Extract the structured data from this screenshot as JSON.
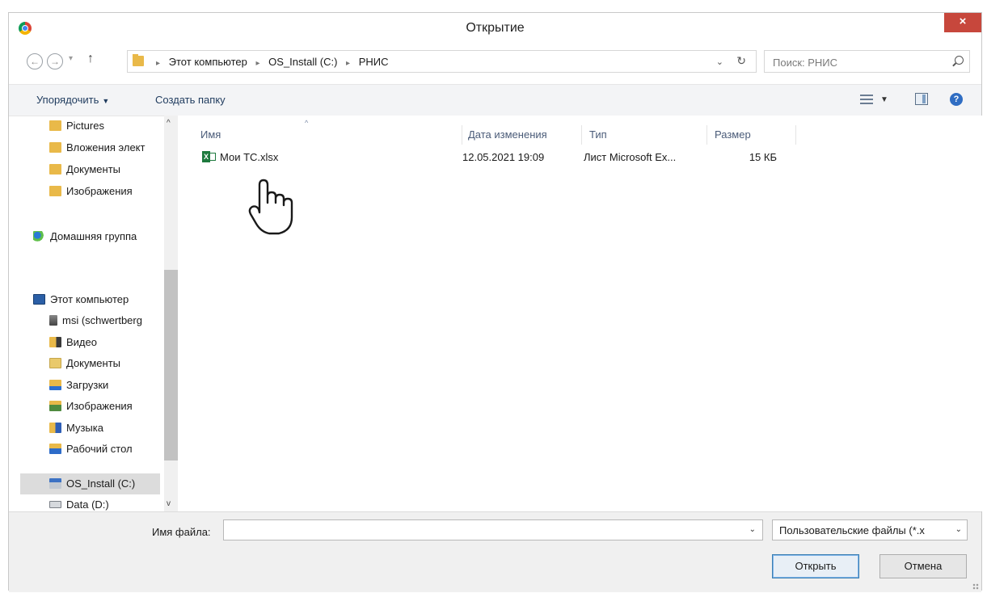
{
  "window": {
    "title": "Открытие",
    "close_label": "×"
  },
  "address": {
    "back_label": "←",
    "forward_label": "→",
    "history_label": "▾",
    "up_label": "↑",
    "crumbs": [
      "Этот компьютер",
      "OS_Install (C:)",
      "РНИС"
    ],
    "crumb_separator": "▸",
    "dropdown_label": "⌄",
    "refresh_label": "↻"
  },
  "search": {
    "placeholder": "Поиск: РНИС"
  },
  "toolbar": {
    "organize_label": "Упорядочить",
    "organize_caret": "▼",
    "new_folder_label": "Создать папку",
    "view_caret": "▼",
    "help_label": "?"
  },
  "nav": {
    "scroll_up": "^",
    "scroll_down": "v",
    "items": [
      {
        "label": "Pictures",
        "icon": "folder-icon"
      },
      {
        "label": "Вложения элект",
        "icon": "folder-icon"
      },
      {
        "label": "Документы",
        "icon": "folder-icon"
      },
      {
        "label": "Изображения",
        "icon": "folder-icon"
      },
      {
        "label": "Домашняя группа",
        "icon": "homegroup-icon"
      },
      {
        "label": "Этот компьютер",
        "icon": "computer-icon"
      },
      {
        "label": "msi (schwertberg",
        "icon": "network-drive-icon"
      },
      {
        "label": "Видео",
        "icon": "video-folder-icon"
      },
      {
        "label": "Документы",
        "icon": "documents-folder-icon"
      },
      {
        "label": "Загрузки",
        "icon": "downloads-folder-icon"
      },
      {
        "label": "Изображения",
        "icon": "pictures-folder-icon"
      },
      {
        "label": "Музыка",
        "icon": "music-folder-icon"
      },
      {
        "label": "Рабочий стол",
        "icon": "desktop-folder-icon"
      },
      {
        "label": "OS_Install (C:)",
        "icon": "system-drive-icon"
      },
      {
        "label": "Data (D:)",
        "icon": "drive-icon"
      }
    ]
  },
  "files": {
    "sort_arrow": "^",
    "columns": [
      "Имя",
      "Дата изменения",
      "Тип",
      "Размер"
    ],
    "rows": [
      {
        "name": "Мои ТС.xlsx",
        "modified": "12.05.2021 19:09",
        "type": "Лист Microsoft Ex...",
        "size": "15 КБ",
        "icon": "excel-file-icon"
      }
    ]
  },
  "bottom": {
    "filename_label": "Имя файла:",
    "filename_value": "",
    "filename_dropdown": "⌄",
    "filetype_value": "Пользовательские файлы (*.x",
    "filetype_dropdown": "⌄",
    "open_label": "Открыть",
    "cancel_label": "Отмена"
  },
  "colors": {
    "close_button": "#c7473c",
    "link_text": "#1f3b5e",
    "folder": "#e9b949",
    "excel": "#1e7a3e"
  }
}
